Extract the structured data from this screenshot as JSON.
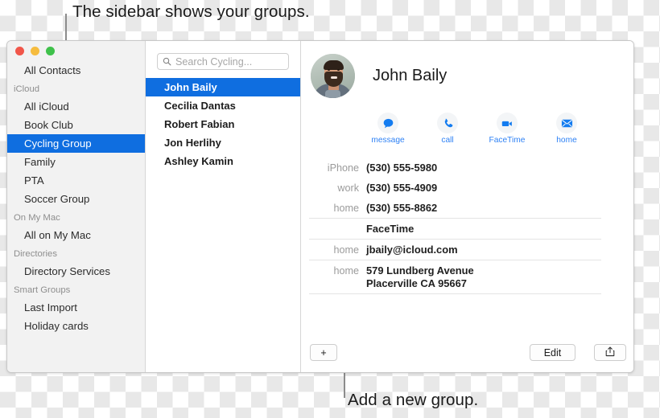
{
  "callouts": {
    "top": "The sidebar shows your groups.",
    "bottom": "Add a new group."
  },
  "window": {
    "traffic_lights": [
      "close",
      "minimize",
      "zoom"
    ],
    "colors": {
      "selection_blue": "#0f6ee0",
      "accent_link": "#2f82f5",
      "sidebar_bg": "#f2f2f2"
    }
  },
  "sidebar": {
    "top_item": {
      "label": "All Contacts"
    },
    "sections": [
      {
        "header": "iCloud",
        "items": [
          {
            "label": "All iCloud",
            "selected": false
          },
          {
            "label": "Book Club",
            "selected": false
          },
          {
            "label": "Cycling Group",
            "selected": true
          },
          {
            "label": "Family",
            "selected": false
          },
          {
            "label": "PTA",
            "selected": false
          },
          {
            "label": "Soccer Group",
            "selected": false
          }
        ]
      },
      {
        "header": "On My Mac",
        "items": [
          {
            "label": "All on My Mac",
            "selected": false
          }
        ]
      },
      {
        "header": "Directories",
        "items": [
          {
            "label": "Directory Services",
            "selected": false
          }
        ]
      },
      {
        "header": "Smart Groups",
        "items": [
          {
            "label": "Last Import",
            "selected": false
          },
          {
            "label": "Holiday cards",
            "selected": false
          }
        ]
      }
    ]
  },
  "search": {
    "placeholder": "Search Cycling...",
    "value": "",
    "icon": "search-icon"
  },
  "contact_list": [
    {
      "name": "John Baily",
      "selected": true
    },
    {
      "name": "Cecilia Dantas",
      "selected": false
    },
    {
      "name": "Robert Fabian",
      "selected": false
    },
    {
      "name": "Jon Herlihy",
      "selected": false
    },
    {
      "name": "Ashley Kamin",
      "selected": false
    }
  ],
  "detail": {
    "name": "John Baily",
    "avatar_alt": "photo of John Baily",
    "actions": [
      {
        "label": "message",
        "icon": "message-bubble-icon"
      },
      {
        "label": "call",
        "icon": "phone-icon"
      },
      {
        "label": "FaceTime",
        "icon": "video-camera-icon"
      },
      {
        "label": "home",
        "icon": "envelope-icon"
      }
    ],
    "field_groups": [
      {
        "rows": [
          {
            "label": "iPhone",
            "value": "(530) 555-5980"
          },
          {
            "label": "work",
            "value": "(530) 555-4909"
          },
          {
            "label": "home",
            "value": "(530) 555-8862"
          }
        ]
      },
      {
        "rows": [
          {
            "label": "",
            "value": "FaceTime"
          }
        ]
      },
      {
        "rows": [
          {
            "label": "home",
            "value": "jbaily@icloud.com"
          }
        ]
      },
      {
        "rows": [
          {
            "label": "home",
            "value": "579 Lundberg Avenue\nPlacerville CA 95667"
          }
        ]
      }
    ]
  },
  "bottom_bar": {
    "add_label": "+",
    "edit_label": "Edit",
    "share_icon": "share-icon"
  }
}
